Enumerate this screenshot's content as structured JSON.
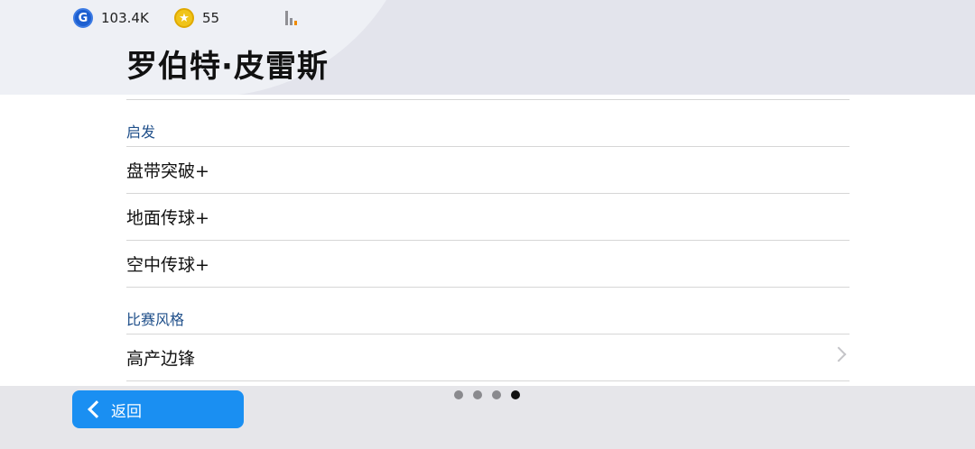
{
  "status_bar": {
    "g_coin_value": "103.4K",
    "star_coin_value": "55"
  },
  "header": {
    "title": "罗伯特·皮雷斯"
  },
  "sections": [
    {
      "header": "启发",
      "items": [
        "盘带突破+",
        "地面传球+",
        "空中传球+"
      ]
    },
    {
      "header": "比赛风格",
      "items": [
        "高产边锋"
      ]
    }
  ],
  "pagination": {
    "total": 4,
    "active_index": 3
  },
  "back_button": {
    "label": "返回"
  },
  "colors": {
    "accent_blue": "#1a8ff2",
    "section_header_blue": "#1f4f8a",
    "signal_orange": "#f08c00"
  }
}
